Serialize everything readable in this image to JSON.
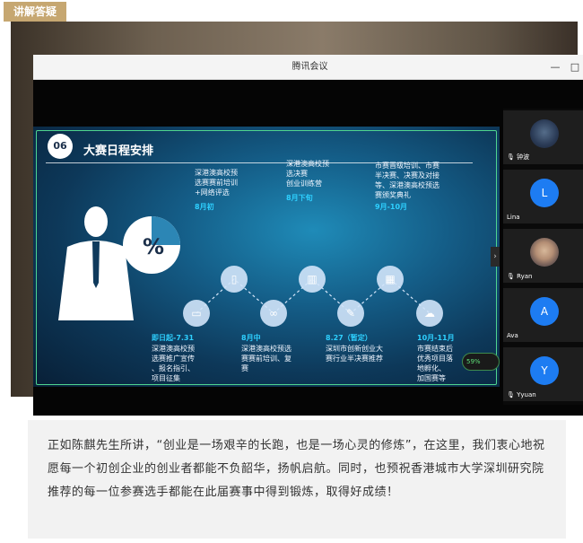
{
  "tag_label": "讲解答疑",
  "window": {
    "title": "腾讯会议",
    "minimize_glyph": "—",
    "maximize_glyph": "□"
  },
  "slide": {
    "number": "06",
    "title": "大赛日程安排",
    "percent_glyph": "%",
    "upper_items": [
      {
        "text": [
          "深港澳高校预",
          "选赛赛前培训",
          "+网络评选"
        ],
        "date": "8月初"
      },
      {
        "text": [
          "深港澳高校预",
          "选决赛",
          "创业训练营"
        ],
        "date": "8月下旬"
      },
      {
        "text": [
          "市赛晋级培训、市赛",
          "半决赛、决赛及对接",
          "等、深港澳高校预选",
          "赛颁奖典礼"
        ],
        "date": "9月-10月"
      }
    ],
    "lower_items": [
      {
        "date": "即日起-7.31",
        "text": [
          "深港澳高校预",
          "选赛推广宣传",
          "、报名指引、",
          "项目征集"
        ]
      },
      {
        "date": "8月中",
        "text": [
          "深港澳高校预选",
          "赛赛前培训、复",
          "赛"
        ]
      },
      {
        "date": "8.27（暂定）",
        "text": [
          "深圳市创新创业大",
          "赛行业半决赛推荐"
        ]
      },
      {
        "date": "10月-11月",
        "text": [
          "市赛结束后",
          "优秀项目落",
          "地孵化、",
          "加国赛等"
        ]
      }
    ],
    "perf_text": "59%"
  },
  "participants": [
    {
      "name": "钟波",
      "avatar_type": "photo-dark",
      "initial": ""
    },
    {
      "name": "Lina",
      "avatar_type": "letter",
      "initial": "L"
    },
    {
      "name": "Ryan",
      "avatar_type": "photo",
      "initial": ""
    },
    {
      "name": "Ava",
      "avatar_type": "letter",
      "initial": "A"
    },
    {
      "name": "Yyuan",
      "avatar_type": "letter",
      "initial": "Y"
    }
  ],
  "caption": "正如陈麒先生所讲，“创业是一场艰辛的长跑，也是一场心灵的修炼”，在这里，我们衷心地祝愿每一个初创企业的创业者都能不负韶华，扬帆启航。同时，也预祝香港城市大学深圳研究院推荐的每一位参赛选手都能在此届赛事中得到锻炼，取得好成绩！"
}
